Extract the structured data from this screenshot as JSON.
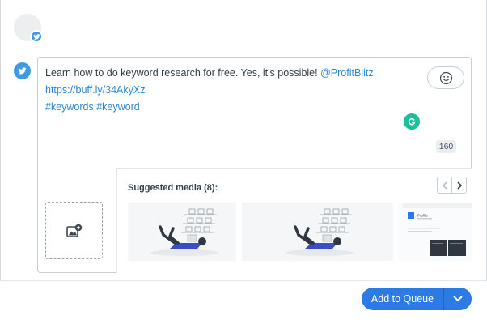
{
  "profile": {
    "avatar_icon": "profile-avatar",
    "network_icon": "twitter-icon",
    "network_color": "#3d9ae8"
  },
  "composer": {
    "text_plain": "Learn how to do keyword research for free. Yes, it's possible!",
    "mention": "@ProfitBlitz",
    "link": "https://buff.ly/34AkyXz",
    "hashtags": "#keywords #keyword",
    "char_count": "160",
    "emoji_icon": "smiley-icon",
    "grammarly_icon": "grammarly-icon",
    "grammarly_color": "#15c39a",
    "link_color": "#2c87d4",
    "upload_icon": "add-image-icon"
  },
  "suggested_media": {
    "title": "Suggested media (8):",
    "prev_icon": "chevron-left-icon",
    "next_icon": "chevron-right-icon",
    "thumbnail_inner_text": "Profile"
  },
  "actions": {
    "add_to_queue_label": "Add to Queue",
    "dropdown_icon": "chevron-down-icon",
    "accent": "#2c7be5"
  }
}
